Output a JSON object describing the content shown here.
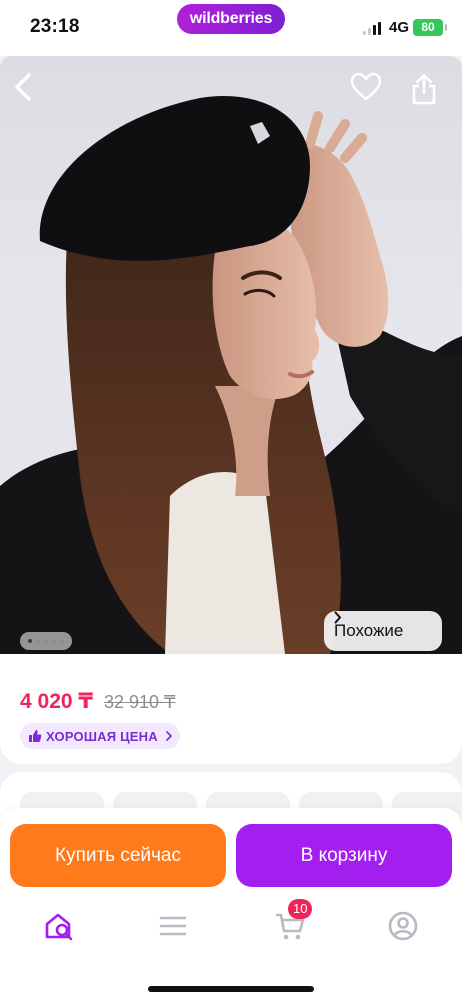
{
  "status_bar": {
    "time": "23:18",
    "network": "4G",
    "battery": "80",
    "icons": [
      "signal-icon",
      "battery-icon"
    ]
  },
  "header": {
    "brand": "wildberries",
    "icons": [
      "back-arrow-icon",
      "heart-icon",
      "share-icon"
    ]
  },
  "gallery": {
    "similar_label": "Похожие",
    "dots": 5,
    "active_dot": 1
  },
  "price": {
    "current": "4 020 ₸",
    "old": "32 910 ₸",
    "badge": "ХОРОШАЯ ЦЕНА",
    "badge_icon": "thumbs-up-icon"
  },
  "actions": {
    "buy_now": "Купить сейчас",
    "add_to_cart": "В корзину"
  },
  "tab_bar": {
    "items": [
      {
        "name": "home-search",
        "icon": "home-search-icon"
      },
      {
        "name": "catalog",
        "icon": "menu-icon"
      },
      {
        "name": "cart",
        "icon": "cart-icon"
      },
      {
        "name": "profile",
        "icon": "profile-icon"
      }
    ],
    "cart_count": "10"
  },
  "colors": {
    "brand_gradient_start": "#b020d8",
    "brand_gradient_end": "#7e1fd6",
    "buy_now": "#ff7a1a",
    "add_to_cart": "#a31ff0",
    "price": "#f0245a",
    "badge_bg": "#f3e9ff",
    "badge_text": "#7a2bd6",
    "tab_icon": "#b9b9c4",
    "tab_active": "#a31ff0"
  }
}
